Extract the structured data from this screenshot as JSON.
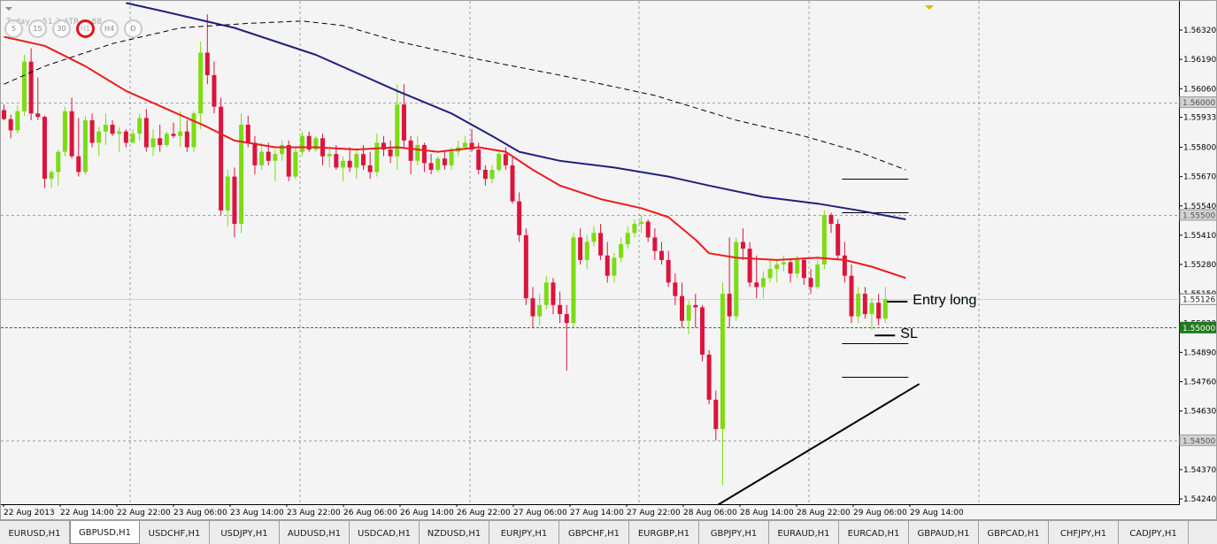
{
  "chart": {
    "symbol": "GBPUSD",
    "period": "H1",
    "ohlc_readout": "Today = 51.3   ATR = 88",
    "colors": {
      "background": "#f4f4f4",
      "grid": "#7e7e7e",
      "bull_candle": "#7cdc14",
      "bear_candle": "#dc143c",
      "ma_fast": "#ee1c1c",
      "ma_slow": "#202080",
      "ma_long": "#000000",
      "bid_line": "#f0d36b",
      "level_line": "#2e7a2e",
      "trend_line": "#000000"
    },
    "timeframes": [
      {
        "label": "5",
        "active": false
      },
      {
        "label": "15",
        "active": false
      },
      {
        "label": "30",
        "active": false
      },
      {
        "label": "H1",
        "active": true
      },
      {
        "label": "H4",
        "active": false
      },
      {
        "label": "D",
        "active": false
      }
    ],
    "price_axis_labels": [
      "1.56320",
      "1.56190",
      "1.56060",
      "1.55933",
      "1.55800",
      "1.55670",
      "1.55540",
      "1.55410",
      "1.55280",
      "1.55150",
      "1.55020",
      "1.54890",
      "1.54760",
      "1.54630",
      "1.54500",
      "1.54370",
      "1.54240"
    ],
    "time_axis_labels": [
      "22 Aug 2013",
      "22 Aug 14:00",
      "22 Aug 22:00",
      "23 Aug 06:00",
      "23 Aug 14:00",
      "23 Aug 22:00",
      "26 Aug 06:00",
      "26 Aug 14:00",
      "26 Aug 22:00",
      "27 Aug 06:00",
      "27 Aug 14:00",
      "27 Aug 22:00",
      "28 Aug 06:00",
      "28 Aug 14:00",
      "28 Aug 22:00",
      "29 Aug 06:00",
      "29 Aug 14:00"
    ],
    "price_flags": [
      {
        "price": 1.56,
        "label": "1.56000",
        "style": "gray"
      },
      {
        "price": 1.555,
        "label": "1.55500",
        "style": "gray"
      },
      {
        "price": 1.55126,
        "label": "1.55126",
        "style": "bid"
      },
      {
        "price": 1.55,
        "label": "1.55000",
        "style": "green"
      },
      {
        "price": 1.545,
        "label": "1.54500",
        "style": "gray"
      }
    ],
    "horizontal_levels": [
      {
        "price": 1.56,
        "style": "gray-dash"
      },
      {
        "price": 1.555,
        "style": "gray-dash"
      },
      {
        "price": 1.55126,
        "style": "bid"
      },
      {
        "price": 1.55,
        "style": "green-dash"
      },
      {
        "price": 1.545,
        "style": "gray-dash"
      }
    ],
    "annotations": [
      {
        "label": "Entry long",
        "price": 1.55115
      },
      {
        "label": "SL",
        "price": 1.54965
      }
    ]
  },
  "chart_data": {
    "type": "candlestick",
    "symbol": "GBPUSD",
    "timeframe": "H1",
    "first_bar": "22 Aug 2013 00:00",
    "last_bar": "29 Aug 2013 17:00",
    "ylim": [
      1.5419,
      1.5645
    ],
    "candles": [
      [
        1.55965,
        1.5599,
        1.5592,
        1.55925
      ],
      [
        1.55925,
        1.55945,
        1.5584,
        1.55875
      ],
      [
        1.55875,
        1.55985,
        1.5586,
        1.5596
      ],
      [
        1.5596,
        1.5621,
        1.5594,
        1.5618
      ],
      [
        1.5618,
        1.5624,
        1.5592,
        1.5595
      ],
      [
        1.5595,
        1.5611,
        1.5592,
        1.55935
      ],
      [
        1.55935,
        1.5594,
        1.5562,
        1.5566
      ],
      [
        1.5566,
        1.557,
        1.5562,
        1.5569
      ],
      [
        1.5569,
        1.5579,
        1.5563,
        1.5578
      ],
      [
        1.5578,
        1.5598,
        1.5576,
        1.5596
      ],
      [
        1.5596,
        1.5602,
        1.5575,
        1.5576
      ],
      [
        1.5576,
        1.5593,
        1.5567,
        1.5569
      ],
      [
        1.5569,
        1.5594,
        1.5568,
        1.5592
      ],
      [
        1.5592,
        1.5595,
        1.558,
        1.5582
      ],
      [
        1.5582,
        1.5589,
        1.5576,
        1.5587
      ],
      [
        1.5587,
        1.5595,
        1.5581,
        1.559
      ],
      [
        1.559,
        1.5592,
        1.5585,
        1.5586
      ],
      [
        1.5586,
        1.5589,
        1.5578,
        1.5587
      ],
      [
        1.5587,
        1.5588,
        1.558,
        1.5582
      ],
      [
        1.5582,
        1.5588,
        1.5582,
        1.5586
      ],
      [
        1.5586,
        1.5595,
        1.5583,
        1.5593
      ],
      [
        1.5593,
        1.5597,
        1.5578,
        1.558
      ],
      [
        1.558,
        1.5588,
        1.5576,
        1.5584
      ],
      [
        1.5584,
        1.559,
        1.5578,
        1.5581
      ],
      [
        1.5581,
        1.5587,
        1.558,
        1.5586
      ],
      [
        1.5586,
        1.5591,
        1.5584,
        1.5585
      ],
      [
        1.5585,
        1.5596,
        1.558,
        1.5587
      ],
      [
        1.5587,
        1.5592,
        1.5578,
        1.558
      ],
      [
        1.558,
        1.5596,
        1.5578,
        1.5595
      ],
      [
        1.5595,
        1.5627,
        1.5588,
        1.5622
      ],
      [
        1.5622,
        1.5639,
        1.5608,
        1.5612
      ],
      [
        1.5612,
        1.5618,
        1.5595,
        1.5598
      ],
      [
        1.5598,
        1.5602,
        1.555,
        1.5552
      ],
      [
        1.5552,
        1.557,
        1.5545,
        1.5567
      ],
      [
        1.5567,
        1.5571,
        1.554,
        1.5546
      ],
      [
        1.5546,
        1.5595,
        1.5542,
        1.559
      ],
      [
        1.559,
        1.5594,
        1.558,
        1.5582
      ],
      [
        1.5582,
        1.5585,
        1.5568,
        1.5572
      ],
      [
        1.5572,
        1.5582,
        1.557,
        1.5578
      ],
      [
        1.5578,
        1.5582,
        1.5572,
        1.5574
      ],
      [
        1.5574,
        1.5579,
        1.5565,
        1.5577
      ],
      [
        1.5577,
        1.5583,
        1.5574,
        1.5581
      ],
      [
        1.5581,
        1.5583,
        1.5565,
        1.5567
      ],
      [
        1.5567,
        1.558,
        1.5566,
        1.5578
      ],
      [
        1.5578,
        1.5587,
        1.5576,
        1.5585
      ],
      [
        1.5585,
        1.5587,
        1.5578,
        1.5579
      ],
      [
        1.5579,
        1.5585,
        1.5578,
        1.5584
      ],
      [
        1.5584,
        1.5586,
        1.5572,
        1.5576
      ],
      [
        1.5576,
        1.5579,
        1.5571,
        1.5577
      ],
      [
        1.5577,
        1.5581,
        1.557,
        1.5571
      ],
      [
        1.5571,
        1.5576,
        1.5565,
        1.5574
      ],
      [
        1.5574,
        1.558,
        1.5569,
        1.5571
      ],
      [
        1.5571,
        1.5579,
        1.5566,
        1.5577
      ],
      [
        1.5577,
        1.5581,
        1.557,
        1.5572
      ],
      [
        1.5572,
        1.5578,
        1.5566,
        1.5569
      ],
      [
        1.5569,
        1.5586,
        1.5567,
        1.5582
      ],
      [
        1.5582,
        1.5585,
        1.5576,
        1.5579
      ],
      [
        1.5579,
        1.5583,
        1.5573,
        1.5576
      ],
      [
        1.5576,
        1.5608,
        1.557,
        1.5599
      ],
      [
        1.5599,
        1.5608,
        1.558,
        1.5583
      ],
      [
        1.5583,
        1.5585,
        1.5568,
        1.5574
      ],
      [
        1.5574,
        1.5585,
        1.5572,
        1.5581
      ],
      [
        1.5581,
        1.5582,
        1.5569,
        1.5573
      ],
      [
        1.5573,
        1.5577,
        1.5568,
        1.557
      ],
      [
        1.557,
        1.5576,
        1.5569,
        1.5575
      ],
      [
        1.5575,
        1.5578,
        1.557,
        1.5572
      ],
      [
        1.5572,
        1.558,
        1.557,
        1.5578
      ],
      [
        1.5578,
        1.5583,
        1.5576,
        1.558
      ],
      [
        1.558,
        1.5585,
        1.5579,
        1.5582
      ],
      [
        1.5582,
        1.5588,
        1.5578,
        1.5579
      ],
      [
        1.5579,
        1.5582,
        1.5568,
        1.557
      ],
      [
        1.557,
        1.5572,
        1.5563,
        1.5566
      ],
      [
        1.5566,
        1.5572,
        1.5564,
        1.557
      ],
      [
        1.557,
        1.5578,
        1.5569,
        1.5577
      ],
      [
        1.5577,
        1.558,
        1.557,
        1.5572
      ],
      [
        1.5572,
        1.5576,
        1.5555,
        1.5556
      ],
      [
        1.5556,
        1.556,
        1.5538,
        1.5541
      ],
      [
        1.5541,
        1.5544,
        1.551,
        1.5513
      ],
      [
        1.5513,
        1.5518,
        1.55,
        1.5505
      ],
      [
        1.5505,
        1.5515,
        1.5501,
        1.551
      ],
      [
        1.551,
        1.5523,
        1.5508,
        1.552
      ],
      [
        1.552,
        1.5522,
        1.5506,
        1.551
      ],
      [
        1.551,
        1.5516,
        1.5502,
        1.5506
      ],
      [
        1.5506,
        1.551,
        1.5481,
        1.5502
      ],
      [
        1.5502,
        1.5542,
        1.55,
        1.554
      ],
      [
        1.554,
        1.5544,
        1.5528,
        1.553
      ],
      [
        1.553,
        1.5541,
        1.5526,
        1.5538
      ],
      [
        1.5538,
        1.5545,
        1.5536,
        1.5542
      ],
      [
        1.5542,
        1.5546,
        1.553,
        1.5532
      ],
      [
        1.5532,
        1.5538,
        1.552,
        1.5523
      ],
      [
        1.5523,
        1.5533,
        1.552,
        1.5531
      ],
      [
        1.5531,
        1.554,
        1.5529,
        1.5537
      ],
      [
        1.5537,
        1.5545,
        1.5535,
        1.5542
      ],
      [
        1.5542,
        1.5548,
        1.554,
        1.5546
      ],
      [
        1.5546,
        1.555,
        1.5542,
        1.5547
      ],
      [
        1.5547,
        1.5548,
        1.5538,
        1.554
      ],
      [
        1.554,
        1.5544,
        1.553,
        1.5534
      ],
      [
        1.5534,
        1.5538,
        1.5528,
        1.553
      ],
      [
        1.553,
        1.5534,
        1.5518,
        1.552
      ],
      [
        1.552,
        1.5524,
        1.551,
        1.5514
      ],
      [
        1.5514,
        1.552,
        1.55,
        1.5503
      ],
      [
        1.5503,
        1.5512,
        1.5497,
        1.551
      ],
      [
        1.551,
        1.5515,
        1.55,
        1.5509
      ],
      [
        1.5509,
        1.551,
        1.5485,
        1.5488
      ],
      [
        1.5488,
        1.549,
        1.5466,
        1.5468
      ],
      [
        1.5468,
        1.5472,
        1.545,
        1.5455
      ],
      [
        1.5455,
        1.552,
        1.543,
        1.5515
      ],
      [
        1.5515,
        1.554,
        1.55,
        1.5505
      ],
      [
        1.5505,
        1.554,
        1.5503,
        1.5538
      ],
      [
        1.5538,
        1.5544,
        1.553,
        1.5535
      ],
      [
        1.5535,
        1.5538,
        1.5518,
        1.552
      ],
      [
        1.552,
        1.5532,
        1.5513,
        1.5518
      ],
      [
        1.5518,
        1.5525,
        1.5513,
        1.5522
      ],
      [
        1.5522,
        1.553,
        1.552,
        1.5526
      ],
      [
        1.5526,
        1.553,
        1.552,
        1.5528
      ],
      [
        1.5528,
        1.5532,
        1.5525,
        1.5529
      ],
      [
        1.5529,
        1.553,
        1.552,
        1.5524
      ],
      [
        1.5524,
        1.5532,
        1.5522,
        1.553
      ],
      [
        1.553,
        1.5531,
        1.5519,
        1.5522
      ],
      [
        1.5522,
        1.5526,
        1.5515,
        1.5518
      ],
      [
        1.5518,
        1.553,
        1.5517,
        1.5528
      ],
      [
        1.5528,
        1.5552,
        1.5526,
        1.555
      ],
      [
        1.555,
        1.5551,
        1.5542,
        1.5546
      ],
      [
        1.5546,
        1.5548,
        1.553,
        1.5532
      ],
      [
        1.5532,
        1.5538,
        1.552,
        1.5523
      ],
      [
        1.5523,
        1.5528,
        1.5502,
        1.5505
      ],
      [
        1.5505,
        1.5518,
        1.5502,
        1.5515
      ],
      [
        1.5515,
        1.5518,
        1.5504,
        1.5506
      ],
      [
        1.5506,
        1.5513,
        1.5499,
        1.5511
      ],
      [
        1.5511,
        1.5515,
        1.5501,
        1.5504
      ],
      [
        1.5504,
        1.5518,
        1.5502,
        1.55126
      ]
    ],
    "series": [
      {
        "name": "MA fast",
        "color": "#ee1c1c",
        "points": [
          [
            0,
            1.5629
          ],
          [
            6,
            1.5625
          ],
          [
            12,
            1.5616
          ],
          [
            18,
            1.5605
          ],
          [
            24,
            1.5597
          ],
          [
            30,
            1.5589
          ],
          [
            34,
            1.5583
          ],
          [
            40,
            1.558
          ],
          [
            46,
            1.558
          ],
          [
            52,
            1.5579
          ],
          [
            58,
            1.558
          ],
          [
            64,
            1.5578
          ],
          [
            70,
            1.558
          ],
          [
            74,
            1.5578
          ],
          [
            78,
            1.557
          ],
          [
            82,
            1.5563
          ],
          [
            88,
            1.5557
          ],
          [
            94,
            1.5553
          ],
          [
            98,
            1.5549
          ],
          [
            102,
            1.5539
          ],
          [
            104,
            1.5533
          ],
          [
            108,
            1.5531
          ],
          [
            114,
            1.553
          ],
          [
            120,
            1.5531
          ],
          [
            124,
            1.553
          ],
          [
            128,
            1.5527
          ],
          [
            133,
            1.5522
          ]
        ]
      },
      {
        "name": "MA slow",
        "color": "#202080",
        "points": [
          [
            18,
            1.5644
          ],
          [
            24,
            1.564
          ],
          [
            34,
            1.5633
          ],
          [
            46,
            1.5621
          ],
          [
            58,
            1.5605
          ],
          [
            66,
            1.5595
          ],
          [
            72,
            1.5585
          ],
          [
            76,
            1.5578
          ],
          [
            82,
            1.5574
          ],
          [
            90,
            1.5571
          ],
          [
            98,
            1.5567
          ],
          [
            104,
            1.5563
          ],
          [
            112,
            1.5558
          ],
          [
            120,
            1.5555
          ],
          [
            126,
            1.5552
          ],
          [
            133,
            1.5548
          ]
        ]
      },
      {
        "name": "MA long",
        "color": "#000000",
        "points": [
          [
            0,
            1.5608
          ],
          [
            6,
            1.5616
          ],
          [
            16,
            1.5626
          ],
          [
            26,
            1.5633
          ],
          [
            36,
            1.5635
          ],
          [
            44,
            1.5636
          ],
          [
            50,
            1.5634
          ],
          [
            58,
            1.5627
          ],
          [
            70,
            1.5619
          ],
          [
            82,
            1.5612
          ],
          [
            96,
            1.5603
          ],
          [
            108,
            1.5592
          ],
          [
            118,
            1.5585
          ],
          [
            126,
            1.5578
          ],
          [
            133,
            1.557
          ]
        ]
      }
    ],
    "trendlines": [
      {
        "x0": 104,
        "y0": 1.5419,
        "x1": 135,
        "y1": 1.5475
      }
    ],
    "measure_lines": [
      {
        "price": 1.5566,
        "from": 124,
        "to": 133
      },
      {
        "price": 1.5551,
        "from": 124,
        "to": 133
      },
      {
        "price": 1.5493,
        "from": 124,
        "to": 133
      },
      {
        "price": 1.5478,
        "from": 124,
        "to": 133
      }
    ]
  },
  "symbol_tabs": [
    {
      "label": "EURUSD,H1",
      "active": false
    },
    {
      "label": "GBPUSD,H1",
      "active": true
    },
    {
      "label": "USDCHF,H1",
      "active": false
    },
    {
      "label": "USDJPY,H1",
      "active": false
    },
    {
      "label": "AUDUSD,H1",
      "active": false
    },
    {
      "label": "USDCAD,H1",
      "active": false
    },
    {
      "label": "NZDUSD,H1",
      "active": false
    },
    {
      "label": "EURJPY,H1",
      "active": false
    },
    {
      "label": "GBPCHF,H1",
      "active": false
    },
    {
      "label": "EURGBP,H1",
      "active": false
    },
    {
      "label": "GBPJPY,H1",
      "active": false
    },
    {
      "label": "EURAUD,H1",
      "active": false
    },
    {
      "label": "EURCAD,H1",
      "active": false
    },
    {
      "label": "GBPAUD,H1",
      "active": false
    },
    {
      "label": "GBPCAD,H1",
      "active": false
    },
    {
      "label": "CHFJPY,H1",
      "active": false
    },
    {
      "label": "CADJPY,H1",
      "active": false
    }
  ]
}
